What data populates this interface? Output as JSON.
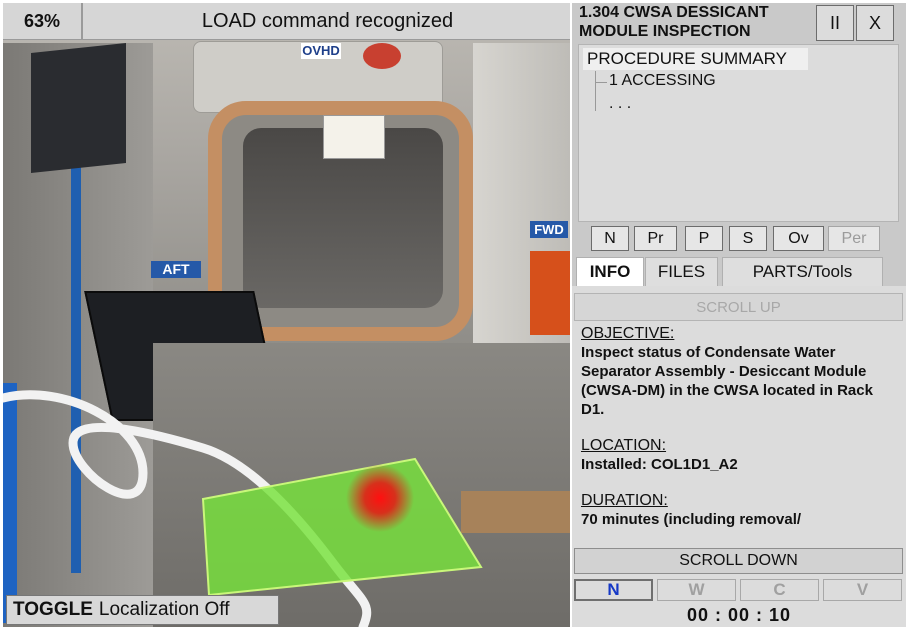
{
  "status": {
    "battery": "63%",
    "message": "LOAD command recognized"
  },
  "scene": {
    "labels": {
      "ovhd": "OVHD",
      "aft": "AFT",
      "fwd": "FWD"
    },
    "target_color": "#76e23a",
    "marker_color": "#e81414"
  },
  "toggle": {
    "keyword": "TOGGLE",
    "label": "Localization Off"
  },
  "procedure": {
    "title_line1": "1.304 CWSA DESSICANT",
    "title_line2": "MODULE INSPECTION",
    "pause_label": "II",
    "close_label": "X",
    "summary_title": "PROCEDURE SUMMARY",
    "steps": [
      "1 ACCESSING",
      ". . ."
    ]
  },
  "nav_buttons": [
    "N",
    "Pr",
    "P",
    "S",
    "Ov",
    "Per"
  ],
  "tabs": [
    "INFO",
    "FILES",
    "PARTS/Tools"
  ],
  "info": {
    "scroll_up": "SCROLL UP",
    "scroll_down": "SCROLL DOWN",
    "objective_heading": "OBJECTIVE:",
    "objective_text": "Inspect status of Condensate Water Separator Assembly - Desiccant Module (CWSA-DM) in the CWSA located in Rack D1.",
    "location_heading": "LOCATION:",
    "location_text": "Installed: COL1D1_A2",
    "duration_heading": "DURATION:",
    "duration_text": "70 minutes (including removal/"
  },
  "mode_buttons": [
    "N",
    "W",
    "C",
    "V"
  ],
  "timer": "00 : 00 : 10"
}
